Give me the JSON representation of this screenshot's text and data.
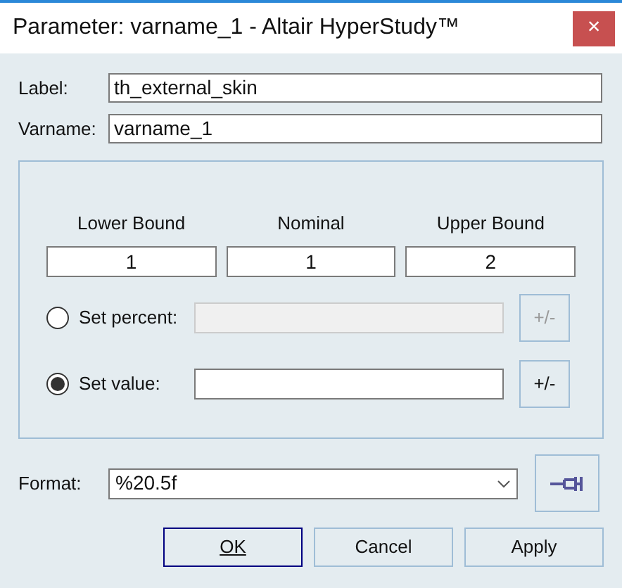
{
  "window": {
    "title": "Parameter: varname_1 - Altair HyperStudy™",
    "close": "×"
  },
  "fields": [
    {
      "label": "Label:",
      "value": "th_external_skin"
    },
    {
      "label": "Varname:",
      "value": "varname_1"
    }
  ],
  "bounds": [
    {
      "heading": "Lower Bound",
      "value": "1"
    },
    {
      "heading": "Nominal",
      "value": "1"
    },
    {
      "heading": "Upper Bound",
      "value": "2"
    }
  ],
  "modes": [
    {
      "label": "Set percent:",
      "selected": false,
      "disabled": true,
      "button": "+/-"
    },
    {
      "label": "Set value:",
      "selected": true,
      "disabled": false,
      "button": "+/-"
    }
  ],
  "format": {
    "label": "Format:",
    "value": "%20.5f"
  },
  "buttons": [
    {
      "label": "OK",
      "selected": true
    },
    {
      "label": "Cancel",
      "selected": false
    },
    {
      "label": "Apply",
      "selected": false
    }
  ]
}
